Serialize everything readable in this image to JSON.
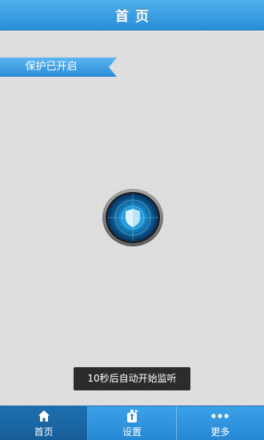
{
  "header": {
    "title": "首页"
  },
  "status": {
    "banner": "保护已开启"
  },
  "toast": {
    "message": "10秒后自动开始监听"
  },
  "tabbar": {
    "tabs": [
      {
        "label": "首页",
        "icon": "home-icon",
        "active": true
      },
      {
        "label": "设置",
        "icon": "settings-icon",
        "active": false
      },
      {
        "label": "更多",
        "icon": "more-icon",
        "active": false
      }
    ]
  },
  "colors": {
    "header": "#2b8fd8",
    "ribbon": "#3d9ee6",
    "toast_bg": "#2c2c2c",
    "tab_active": "#1d6fb0"
  }
}
